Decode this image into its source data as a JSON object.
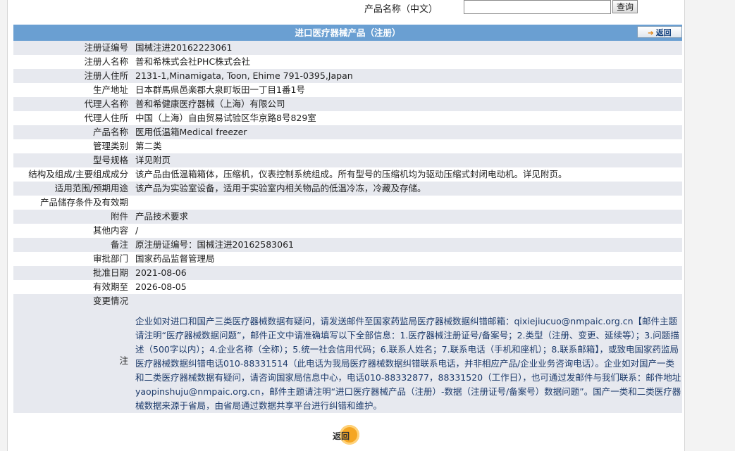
{
  "search": {
    "label": "产品名称（中文）",
    "value": "",
    "placeholder": "",
    "button": "查询"
  },
  "panel": {
    "title": "进口医疗器械产品（注册）",
    "back_top": "返回",
    "back_bottom": "返回"
  },
  "rows": [
    {
      "label": "注册证编号",
      "value": "国械注进20162223061"
    },
    {
      "label": "注册人名称",
      "value": "普和希株式会社PHC株式会社"
    },
    {
      "label": "注册人住所",
      "value": "2131-1,Minamigata, Toon, Ehime 791-0395,Japan"
    },
    {
      "label": "生产地址",
      "value": "日本群馬県邑楽郡大泉町坂田一丁目1番1号"
    },
    {
      "label": "代理人名称",
      "value": "普和希健康医疗器械（上海）有限公司"
    },
    {
      "label": "代理人住所",
      "value": "中国（上海）自由贸易试验区华京路8号829室"
    },
    {
      "label": "产品名称",
      "value": "医用低温箱Medical freezer"
    },
    {
      "label": "管理类别",
      "value": "第二类"
    },
    {
      "label": "型号规格",
      "value": "详见附页"
    },
    {
      "label": "结构及组成/主要组成成分",
      "value": "该产品由低温箱箱体，压缩机，仪表控制系统组成。所有型号的压缩机均为驱动压缩式封闭电动机。详见附页。"
    },
    {
      "label": "适用范围/预期用途",
      "value": "该产品为实验室设备，适用于实验室内相关物品的低温冷冻，冷藏及存储。"
    },
    {
      "label": "产品储存条件及有效期",
      "value": ""
    },
    {
      "label": "附件",
      "value": "产品技术要求"
    },
    {
      "label": "其他内容",
      "value": "/"
    },
    {
      "label": "备注",
      "value": "原注册证编号：国械注进20162583061"
    },
    {
      "label": "审批部门",
      "value": "国家药品监督管理局"
    },
    {
      "label": "批准日期",
      "value": "2021-08-06"
    },
    {
      "label": "有效期至",
      "value": "2026-08-05"
    },
    {
      "label": "变更情况",
      "value": ""
    }
  ],
  "note": {
    "label": "注",
    "text": "企业如对进口和国产三类医疗器械数据有疑问，请发送邮件至国家药监局医疗器械数据纠错邮箱：qixiejiucuo@nmpaic.org.cn【邮件主题请注明“医疗器械数据问题”，邮件正文中请准确填写以下全部信息：1.医疗器械注册证号/备案号；2.类型（注册、变更、延续等）；3.问题描述（500字以内）；4.企业名称（全称）；5.统一社会信用代码；6.联系人姓名；7.联系电话（手机和座机）；8.联系邮箱】，或致电国家药监局医疗器械数据纠错电话010-88331514（此电话为我局医疗器械数据纠错联系电话，并非相应产品/企业业务咨询电话）。企业如对国产一类和二类医疗器械数据有疑问，请咨询国家局信息中心，电话010-88332877，88331520（工作日），也可通过发邮件与我们联系：邮件地址yaopinshuju@nmpaic.org.cn，邮件主题请注明“进口医疗器械产品（注册）-数据（注册证号/备案号）数据问题”。国产一类和二类医疗器械数据来源于省局，由省局通过数据共享平台进行纠错和维护。"
  }
}
